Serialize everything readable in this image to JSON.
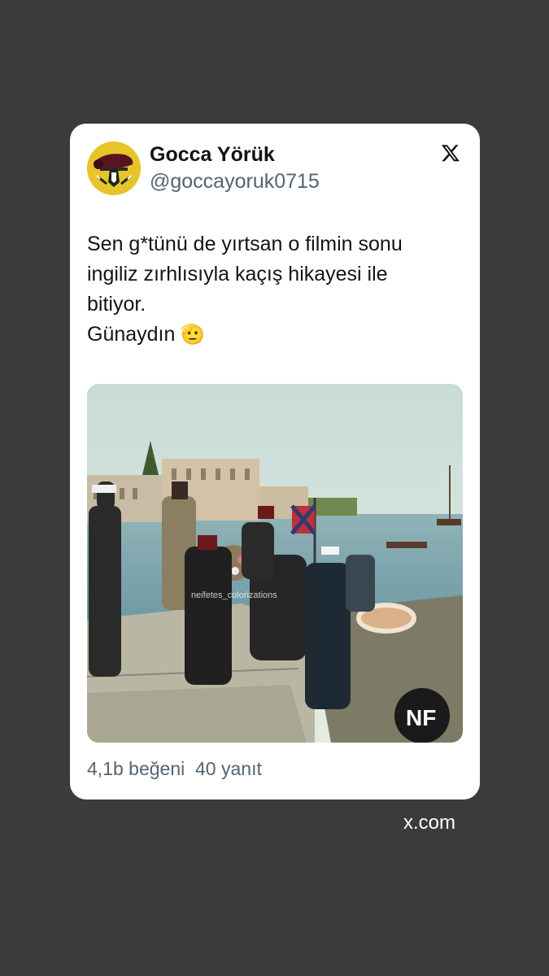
{
  "tweet": {
    "display_name": "Gocca Yörük",
    "handle": "@goccayoruk0715",
    "text_lines": [
      "Sen g*tünü de yırtsan o filmin sonu",
      "ingiliz zırhlısıyla kaçış hikayesi ile",
      "bitiyor.",
      "Günaydın"
    ],
    "emoji": "🫡",
    "platform_icon": "x-logo-icon",
    "image": {
      "description_icon": "historical-photo",
      "watermark": "neifetes_colorizations",
      "logo_text": "NF"
    },
    "likes_label": "4,1b beğeni",
    "replies_label": "40 yanıt"
  },
  "footer": {
    "source": "x.com"
  },
  "colors": {
    "background": "#3b3b3b",
    "card": "#ffffff",
    "text_primary": "#0f1419",
    "text_secondary": "#536471",
    "avatar_bg": "#e6c52a"
  }
}
